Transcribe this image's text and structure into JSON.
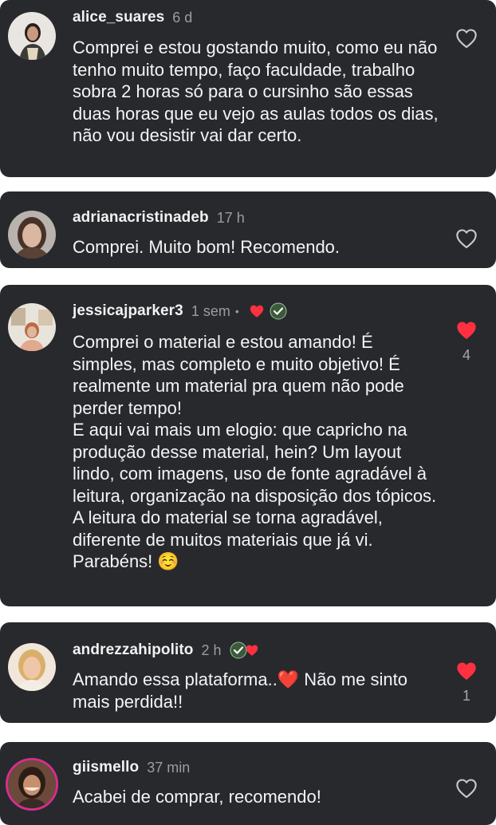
{
  "comments": [
    {
      "username": "alice_suares",
      "time": "6 d",
      "text": "Comprei e estou gostando muito, como eu não tenho muito tempo, faço faculdade, trabalho sobra 2 horas só para o cursinho são essas duas horas que eu vejo as aulas todos os dias, não vou desistir vai dar certo.",
      "liked": false,
      "avatar_icon": "user-avatar-photo"
    },
    {
      "username": "adrianacristinadeb",
      "time": "17 h",
      "text": "Comprei. Muito bom! Recomendo.",
      "liked": false,
      "avatar_icon": "user-avatar-photo"
    },
    {
      "username": "jessicajparker3",
      "time": "1 sem",
      "separator": "•",
      "text": "Comprei o material e estou amando! É simples, mas completo e muito objetivo! É realmente um material pra quem não pode perder tempo!\nE aqui vai mais um elogio: que capricho na produção desse material, hein? Um layout lindo, com imagens, uso de fonte agradável à leitura, organização na disposição dos tópicos. A leitura do material se torna agradável, diferente de muitos materiais que já vi.\nParabéns! ☺️",
      "liked": true,
      "like_count": "4",
      "avatar_icon": "user-avatar-photo"
    },
    {
      "username": "andrezzahipolito",
      "time": "2 h",
      "text": "Amando essa plataforma..❤️ Não me sinto mais perdida!!",
      "liked": true,
      "like_count": "1",
      "avatar_icon": "user-avatar-photo"
    },
    {
      "username": "giismello",
      "time": "37 min",
      "text": "Acabei de comprar, recomendo!",
      "liked": false,
      "avatar_icon": "user-avatar-photo-story-ring"
    }
  ],
  "colors": {
    "card_bg": "#27292d",
    "text": "#f4f4f4",
    "muted": "#9a9ca2",
    "like_red": "#ff3040",
    "story_ring": "#d42f89"
  }
}
